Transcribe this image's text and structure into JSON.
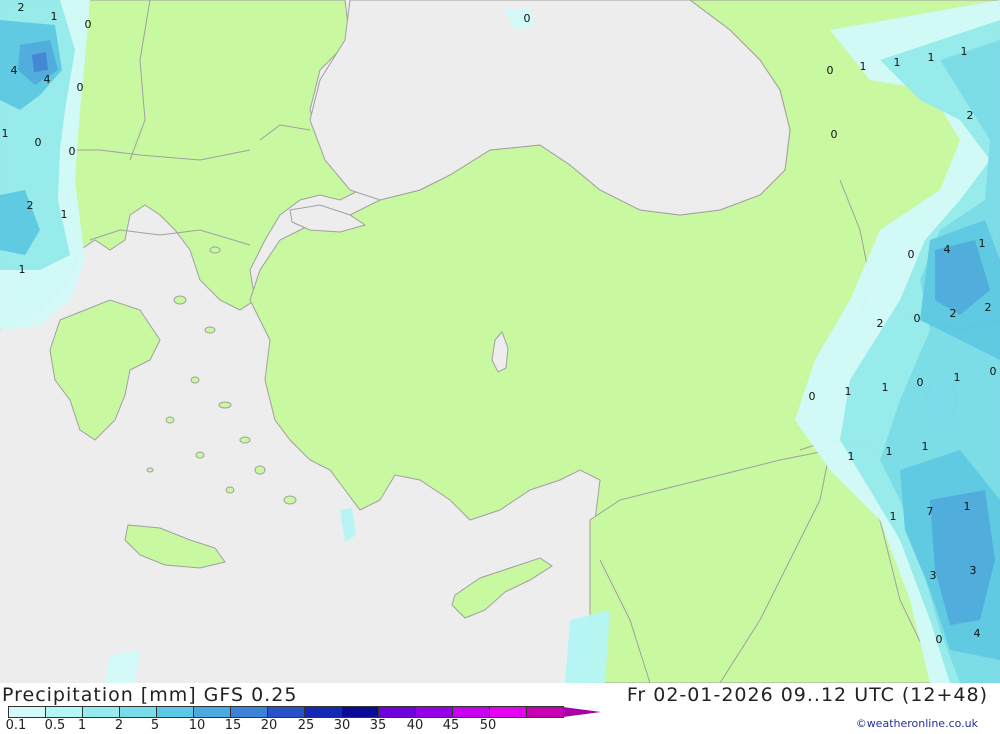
{
  "title_left": "Precipitation [mm] GFS 0.25",
  "title_right": "Fr 02-01-2026 09..12 UTC (12+48)",
  "credit": "©weatheronline.co.uk",
  "colors": {
    "sea": "#ededed",
    "land": "#c8f8a0",
    "border": "#a0a0a0",
    "scale": [
      "#d2fafa",
      "#b4f5f5",
      "#96ebf0",
      "#78dcea",
      "#5ac8e6",
      "#4aaae0",
      "#3c82d8",
      "#2850c8",
      "#1428b4",
      "#0a0a96",
      "#6e00dc",
      "#9600e6",
      "#c800f0",
      "#e600f0",
      "#c800b4",
      "#a800a8"
    ]
  },
  "legend": {
    "labels": [
      "0.1",
      "0.5",
      "1",
      "2",
      "5",
      "10",
      "15",
      "20",
      "25",
      "30",
      "35",
      "40",
      "45",
      "50"
    ]
  },
  "map_labels": [
    "2",
    "1",
    "0",
    "4",
    "4",
    "0",
    "1",
    "0",
    "0",
    "2",
    "1",
    "1",
    "0",
    "0",
    "1",
    "1",
    "1",
    "1",
    "0",
    "2",
    "0",
    "4",
    "1",
    "0",
    "2",
    "2",
    "2",
    "1",
    "1",
    "0",
    "0",
    "1",
    "0",
    "1",
    "1",
    "1",
    "1",
    "7",
    "1",
    "3",
    "3",
    "0",
    "4"
  ]
}
